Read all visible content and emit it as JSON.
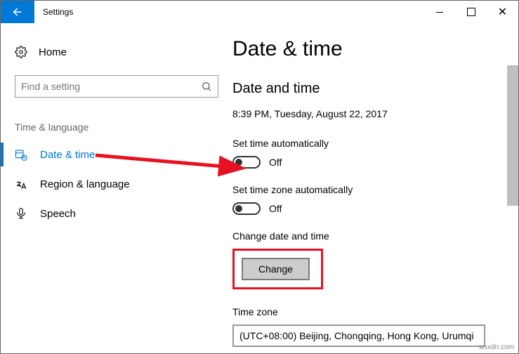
{
  "titlebar": {
    "title": "Settings"
  },
  "sidebar": {
    "home_label": "Home",
    "search_placeholder": "Find a setting",
    "category": "Time & language",
    "items": [
      {
        "label": "Date & time"
      },
      {
        "label": "Region & language"
      },
      {
        "label": "Speech"
      }
    ]
  },
  "main": {
    "heading": "Date & time",
    "subheading": "Date and time",
    "current_datetime": "8:39 PM, Tuesday, August 22, 2017",
    "set_time_auto_label": "Set time automatically",
    "set_time_auto_state": "Off",
    "set_tz_auto_label": "Set time zone automatically",
    "set_tz_auto_state": "Off",
    "change_dt_label": "Change date and time",
    "change_button": "Change",
    "tz_label": "Time zone",
    "tz_value": "(UTC+08:00) Beijing, Chongqing, Hong Kong, Urumqi"
  },
  "annotation": {
    "highlight_color": "#e81123"
  },
  "watermark": "wsxdn.com"
}
